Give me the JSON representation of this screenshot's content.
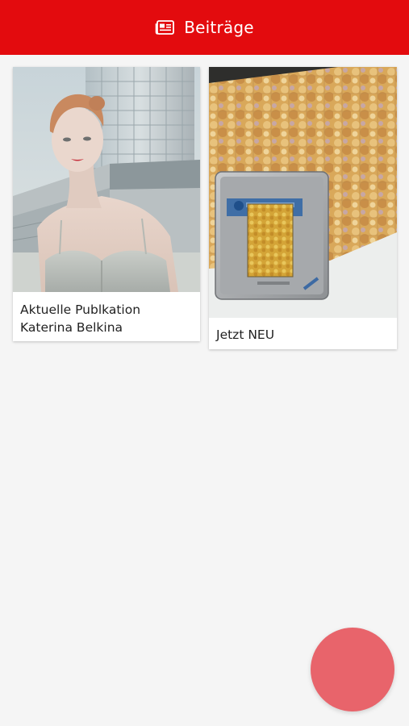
{
  "app_bar": {
    "title": "Beiträge",
    "icon": "newspaper-icon",
    "background": "#e30b0e"
  },
  "posts": [
    {
      "title_line1": "Aktuelle Publkation",
      "title_line2": "Katerina Belkina",
      "image": "woman-portrait-building-photo"
    },
    {
      "title_line1": "Jetzt NEU",
      "image": "puzzle-box-photo"
    }
  ],
  "fab": {
    "color": "#e8646b"
  }
}
